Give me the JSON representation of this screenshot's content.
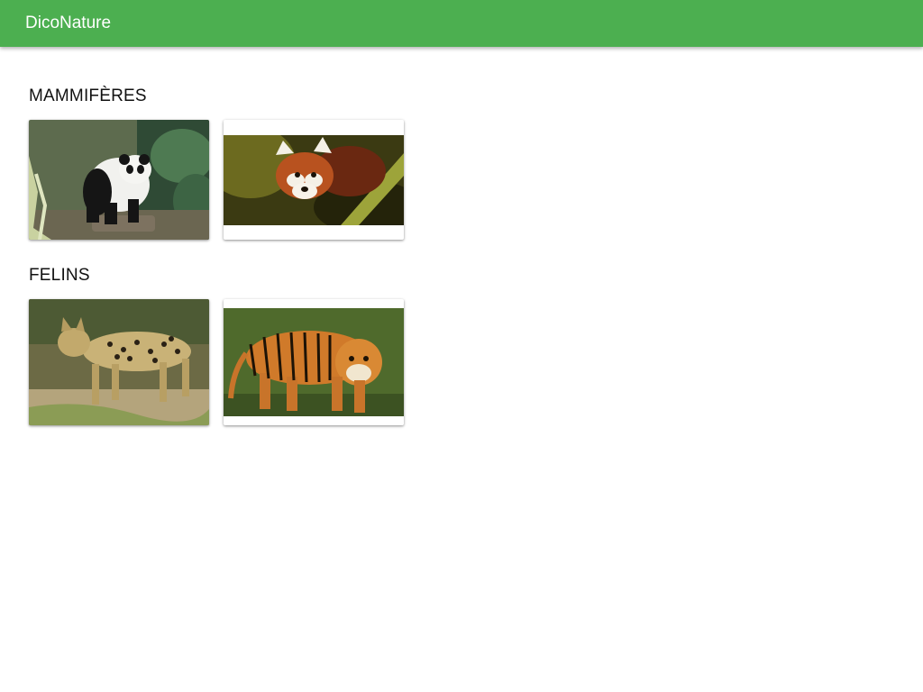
{
  "app": {
    "title": "DicoNature"
  },
  "sections": [
    {
      "title": "MAMMIFÈRES",
      "items": [
        {
          "image": "giant-panda"
        },
        {
          "image": "red-panda"
        }
      ]
    },
    {
      "title": "FELINS",
      "items": [
        {
          "image": "serval"
        },
        {
          "image": "tiger"
        }
      ]
    }
  ],
  "colors": {
    "appbar": "#4caf50",
    "appbar_text": "#ffffff"
  }
}
